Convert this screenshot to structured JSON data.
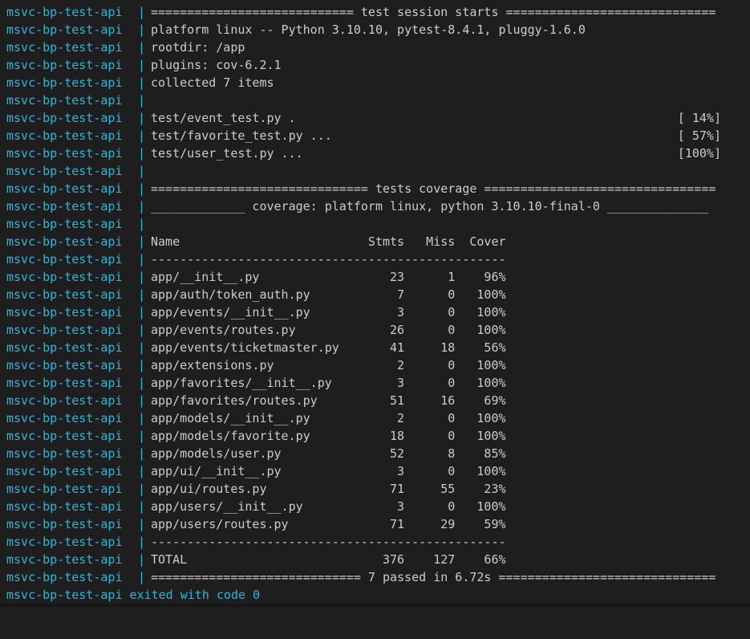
{
  "terminal": {
    "service_name": "msvc-bp-test-api",
    "separator": "|",
    "colors": {
      "background": "#1e1e1e",
      "service": "#29b8db",
      "text": "#cccccc"
    },
    "lines": [
      {
        "content": "============================ test session starts ============================="
      },
      {
        "content": "platform linux -- Python 3.10.10, pytest-8.4.1, pluggy-1.6.0"
      },
      {
        "content": "rootdir: /app"
      },
      {
        "content": "plugins: cov-6.2.1"
      },
      {
        "content": "collected 7 items"
      },
      {
        "content": ""
      },
      {
        "content": "test/event_test.py .",
        "progress": "[ 14%]"
      },
      {
        "content": "test/favorite_test.py ...",
        "progress": "[ 57%]"
      },
      {
        "content": "test/user_test.py ...",
        "progress": "[100%]"
      },
      {
        "content": ""
      },
      {
        "content": "============================== tests coverage ================================"
      },
      {
        "content": "_____________ coverage: platform linux, python 3.10.10-final-0 ______________"
      },
      {
        "content": ""
      },
      {
        "content": "Name                          Stmts   Miss  Cover"
      },
      {
        "content": "-------------------------------------------------"
      },
      {
        "content": "app/__init__.py                  23      1    96%"
      },
      {
        "content": "app/auth/token_auth.py            7      0   100%"
      },
      {
        "content": "app/events/__init__.py            3      0   100%"
      },
      {
        "content": "app/events/routes.py             26      0   100%"
      },
      {
        "content": "app/events/ticketmaster.py       41     18    56%"
      },
      {
        "content": "app/extensions.py                 2      0   100%"
      },
      {
        "content": "app/favorites/__init__.py         3      0   100%"
      },
      {
        "content": "app/favorites/routes.py          51     16    69%"
      },
      {
        "content": "app/models/__init__.py            2      0   100%"
      },
      {
        "content": "app/models/favorite.py           18      0   100%"
      },
      {
        "content": "app/models/user.py               52      8    85%"
      },
      {
        "content": "app/ui/__init__.py                3      0   100%"
      },
      {
        "content": "app/ui/routes.py                 71     55    23%"
      },
      {
        "content": "app/users/__init__.py             3      0   100%"
      },
      {
        "content": "app/users/routes.py              71     29    59%"
      },
      {
        "content": "-------------------------------------------------"
      },
      {
        "content": "TOTAL                           376    127    66%"
      },
      {
        "content": "============================= 7 passed in 6.72s =============================="
      }
    ],
    "exit_message": "msvc-bp-test-api exited with code 0"
  }
}
